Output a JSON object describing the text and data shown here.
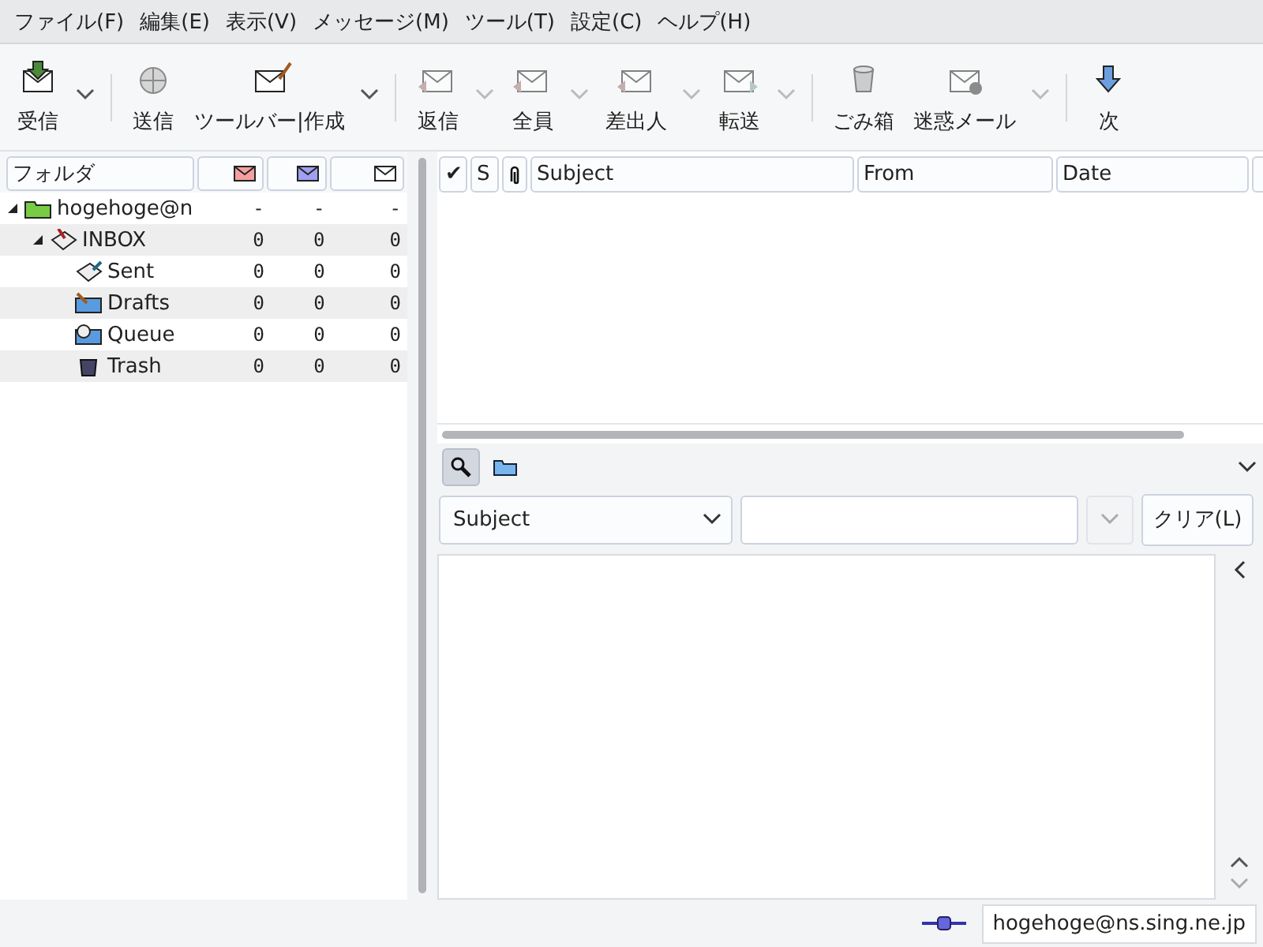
{
  "menu": [
    "ファイル(F)",
    "編集(E)",
    "表示(V)",
    "メッセージ(M)",
    "ツール(T)",
    "設定(C)",
    "ヘルプ(H)"
  ],
  "toolbar": [
    [
      {
        "label": "受信",
        "kind": "receive",
        "disabled": false,
        "has_menu": true
      }
    ],
    [
      {
        "label": "送信",
        "kind": "send",
        "disabled": true,
        "has_menu": false
      },
      {
        "label": "ツールバー|作成",
        "kind": "compose",
        "disabled": false,
        "has_menu": true
      }
    ],
    [
      {
        "label": "返信",
        "kind": "reply",
        "disabled": true,
        "has_menu": true
      },
      {
        "label": "全員",
        "kind": "reply-all",
        "disabled": true,
        "has_menu": true
      },
      {
        "label": "差出人",
        "kind": "reply-sender",
        "disabled": true,
        "has_menu": true
      },
      {
        "label": "転送",
        "kind": "forward",
        "disabled": true,
        "has_menu": true
      }
    ],
    [
      {
        "label": "ごみ箱",
        "kind": "trash",
        "disabled": true,
        "has_menu": false
      },
      {
        "label": "迷惑メール",
        "kind": "junk",
        "disabled": true,
        "has_menu": true
      }
    ],
    [
      {
        "label": "次",
        "kind": "next",
        "disabled": false,
        "has_menu": false
      }
    ]
  ],
  "folder_tree": {
    "columns": [
      {
        "kind": "text",
        "label": "フォルダ"
      },
      {
        "kind": "unread"
      },
      {
        "kind": "new"
      },
      {
        "kind": "total"
      }
    ],
    "items": [
      {
        "name": "hogehoge@n",
        "expanded": true,
        "counts": [
          "-",
          "-",
          "-"
        ],
        "children": [
          {
            "name": "INBOX",
            "expanded": true,
            "counts": [
              "0",
              "0",
              "0"
            ],
            "children": [
              {
                "name": "Sent",
                "counts": [
                  "0",
                  "0",
                  "0"
                ]
              },
              {
                "name": "Drafts",
                "counts": [
                  "0",
                  "0",
                  "0"
                ]
              },
              {
                "name": "Queue",
                "counts": [
                  "0",
                  "0",
                  "0"
                ]
              },
              {
                "name": "Trash",
                "counts": [
                  "0",
                  "0",
                  "0"
                ]
              }
            ]
          }
        ]
      }
    ]
  },
  "message_list": {
    "columns": [
      {
        "kind": "text",
        "label": "✔"
      },
      {
        "kind": "text",
        "label": "S"
      },
      {
        "kind": "attachment"
      },
      {
        "kind": "text",
        "label": "Subject"
      },
      {
        "kind": "text",
        "label": "From"
      },
      {
        "kind": "text",
        "label": "Date"
      },
      {
        "kind": "blank"
      }
    ]
  },
  "search": {
    "tabs": [
      {
        "kind": "search",
        "selected": true
      },
      {
        "kind": "folder",
        "selected": false
      }
    ],
    "field_select": "Subject",
    "clear_button": "クリア(L)"
  },
  "status_bar": {
    "online": true,
    "account": "hogehoge@ns.sing.ne.jp"
  }
}
